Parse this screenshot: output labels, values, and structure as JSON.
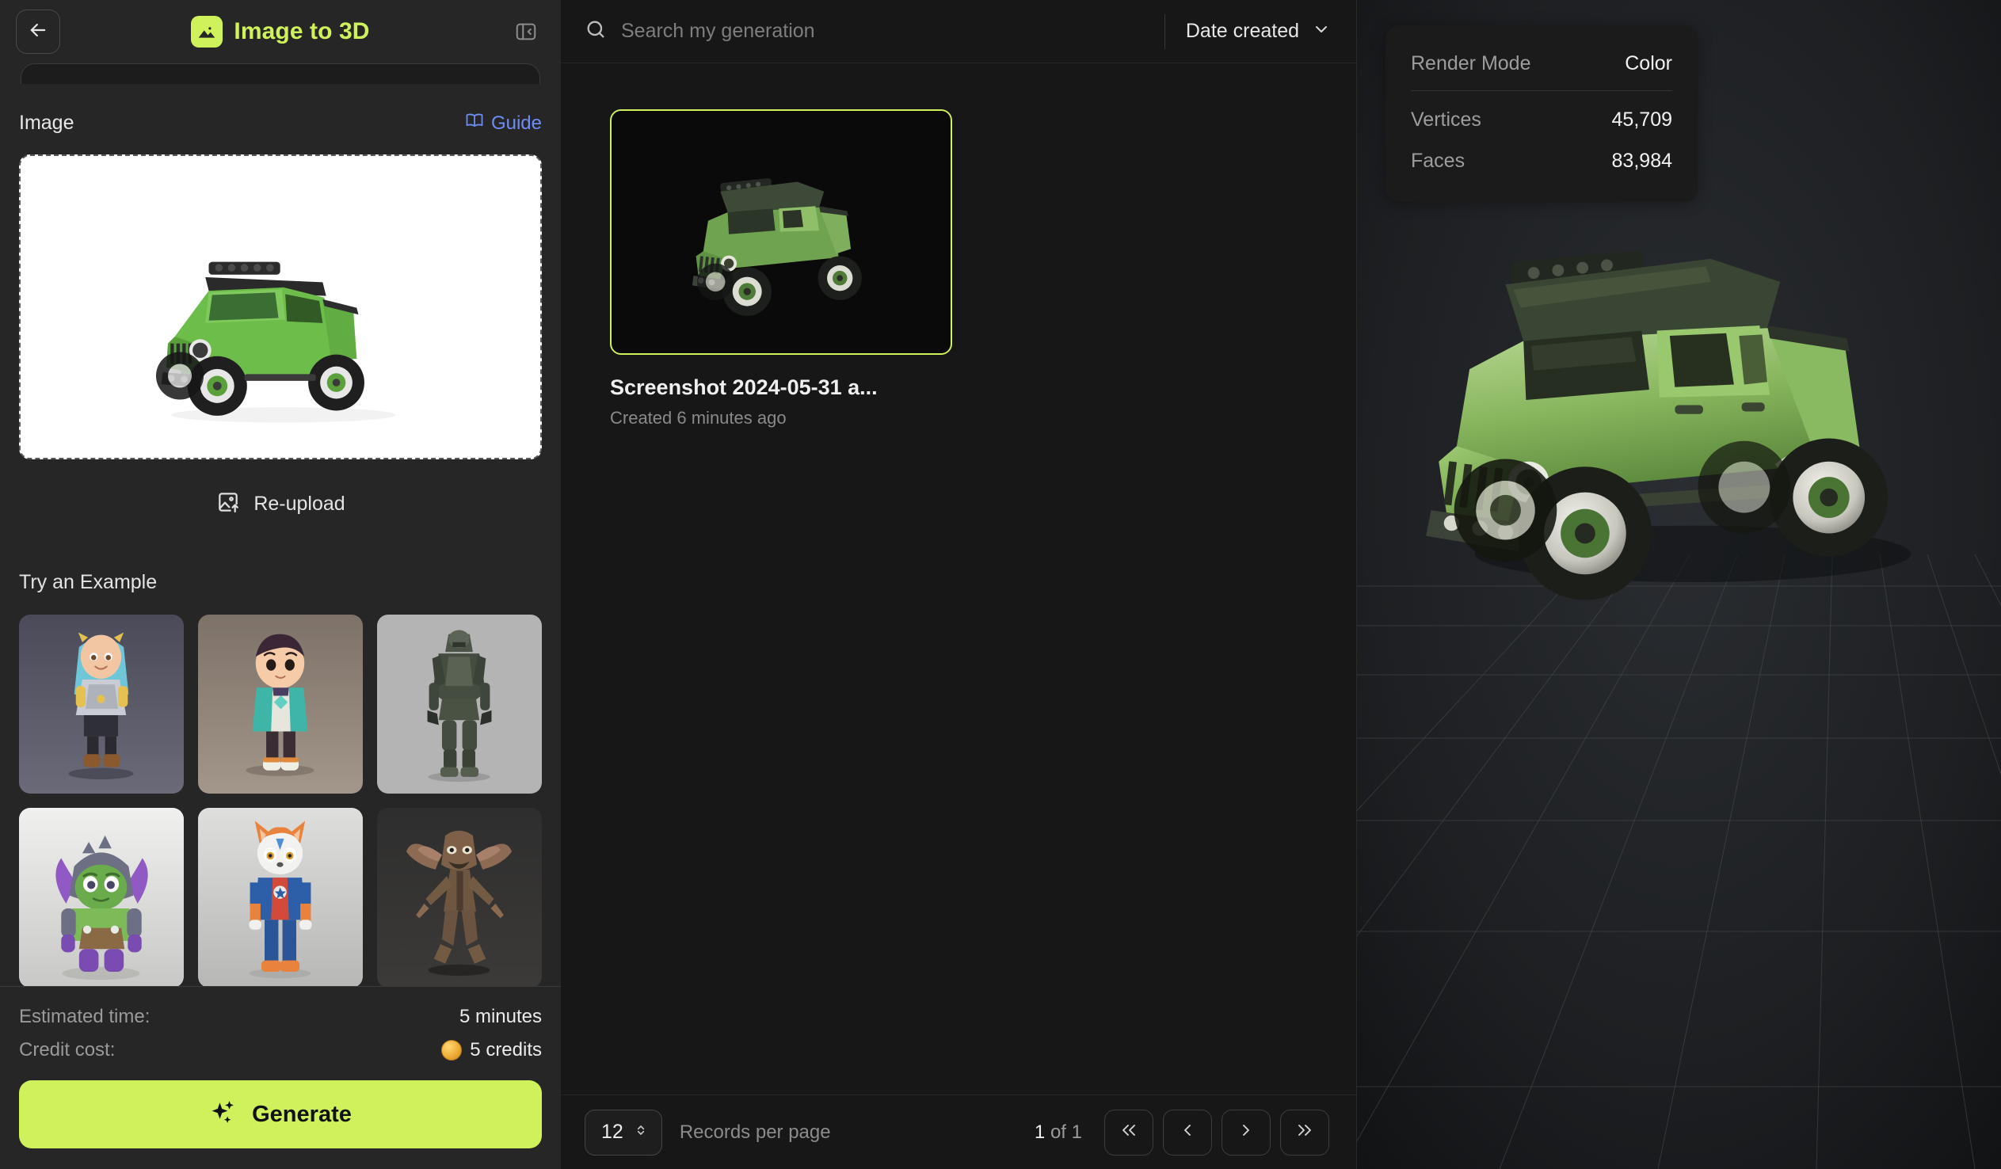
{
  "accent": "#cff25c",
  "sidebar": {
    "back_icon": "arrow-left-icon",
    "title": "Image to 3D",
    "title_icon": "image-icon",
    "collapse_icon": "panel-collapse-icon",
    "image_section": {
      "heading": "Image",
      "guide_label": "Guide",
      "guide_icon": "book-icon",
      "uploaded_preview_alt": "green off-road jeep truck on white background",
      "reupload_label": "Re-upload",
      "reupload_icon": "image-upload-icon"
    },
    "examples": {
      "heading": "Try an Example",
      "items": [
        {
          "name": "knight-girl-example"
        },
        {
          "name": "boy-character-example"
        },
        {
          "name": "armored-robot-example"
        },
        {
          "name": "horned-orc-example"
        },
        {
          "name": "fox-character-example"
        },
        {
          "name": "goblin-creature-example"
        }
      ]
    },
    "footer": {
      "estimated_time_label": "Estimated time:",
      "estimated_time_value": "5 minutes",
      "credit_cost_label": "Credit cost:",
      "credit_cost_value": "5 credits",
      "credit_icon": "coin-icon",
      "generate_label": "Generate",
      "generate_icon": "sparkles-icon"
    }
  },
  "middle": {
    "search": {
      "placeholder": "Search my generation",
      "value": "",
      "icon": "search-icon"
    },
    "sort": {
      "label": "Date created",
      "icon": "chevron-down-icon"
    },
    "generations": [
      {
        "name": "Screenshot 2024-05-31 a...",
        "created": "Created 6 minutes ago",
        "selected": true,
        "thumb_alt": "generated green jeep 3d model"
      }
    ],
    "pager": {
      "records_per_page": "12",
      "records_per_page_label": "Records per page",
      "stepper_icon": "stepper-updown-icon",
      "page_current": "1",
      "page_of": "of",
      "page_total": "1",
      "first_icon": "chevrons-left-icon",
      "prev_icon": "chevron-left-icon",
      "next_icon": "chevron-right-icon",
      "last_icon": "chevrons-right-icon"
    }
  },
  "viewer": {
    "stats": [
      {
        "key": "Render Mode",
        "value": "Color"
      },
      {
        "key": "Vertices",
        "value": "45,709"
      },
      {
        "key": "Faces",
        "value": "83,984"
      }
    ],
    "model_alt": "green off-road jeep 3d model on grid floor"
  }
}
